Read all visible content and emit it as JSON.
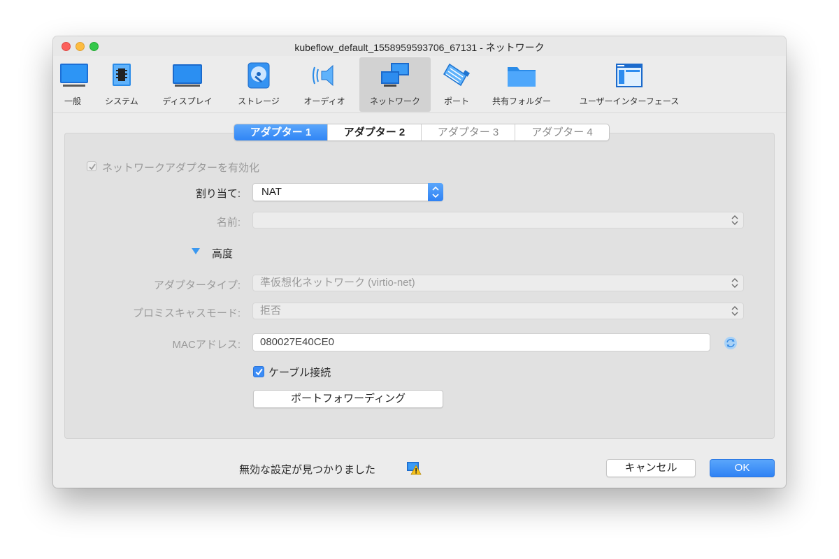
{
  "window": {
    "title": "kubeflow_default_1558959593706_67131 - ネットワーク"
  },
  "toolbar": {
    "items": [
      {
        "label": "一般"
      },
      {
        "label": "システム"
      },
      {
        "label": "ディスプレイ"
      },
      {
        "label": "ストレージ"
      },
      {
        "label": "オーディオ"
      },
      {
        "label": "ネットワーク"
      },
      {
        "label": "ポート"
      },
      {
        "label": "共有フォルダー"
      },
      {
        "label": "ユーザーインターフェース"
      }
    ],
    "active": "ネットワーク"
  },
  "tabs": [
    {
      "label": "アダプター 1"
    },
    {
      "label": "アダプター 2"
    },
    {
      "label": "アダプター 3"
    },
    {
      "label": "アダプター 4"
    }
  ],
  "form": {
    "enable_adapter_label": "ネットワークアダプターを有効化",
    "attached_label": "割り当て:",
    "attached_value": "NAT",
    "name_label": "名前:",
    "name_value": "",
    "advanced_label": "高度",
    "adapter_type_label": "アダプタータイプ:",
    "adapter_type_value": "準仮想化ネットワーク (virtio-net)",
    "promiscuous_label": "プロミスキャスモード:",
    "promiscuous_value": "拒否",
    "mac_label": "MACアドレス:",
    "mac_value": "080027E40CE0",
    "cable_label": "ケーブル接続",
    "port_forwarding_label": "ポートフォワーディング"
  },
  "footer": {
    "status": "無効な設定が見つかりました",
    "cancel": "キャンセル",
    "ok": "OK"
  },
  "colors": {
    "accent": "#3085f5",
    "close": "#fc605b",
    "minimize": "#fdbc40",
    "maximize": "#34c84a"
  }
}
